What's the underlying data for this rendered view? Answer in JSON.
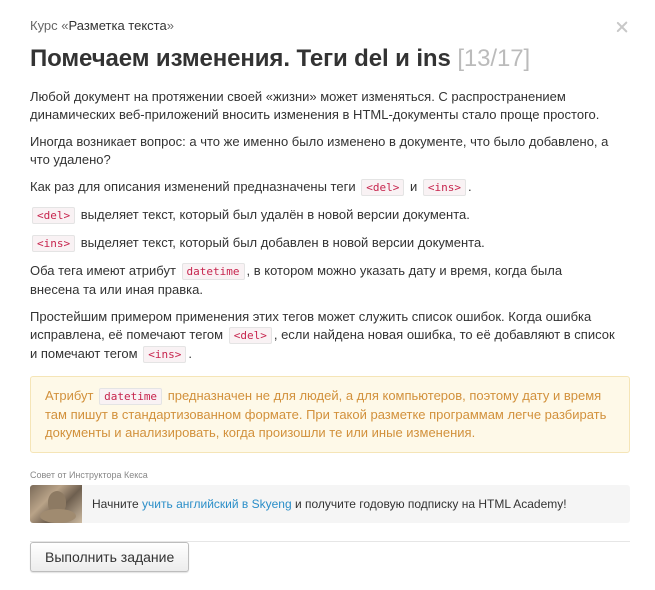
{
  "breadcrumb": {
    "prefix": "Курс «",
    "course": "Разметка текста",
    "suffix": "»"
  },
  "title": {
    "text": "Помечаем изменения. Теги del и ins",
    "counter": "[13/17]"
  },
  "paragraphs": {
    "p1": "Любой документ на протяжении своей «жизни» может изменяться. С распространением динамических веб-приложений вносить изменения в HTML-документы стало проще простого.",
    "p2": "Иногда возникает вопрос: а что же именно было изменено в документе, что было добавлено, а что удалено?",
    "p3_a": "Как раз для описания изменений предназначены теги",
    "p3_code1": "<del>",
    "p3_b": "и",
    "p3_code2": "<ins>",
    "p3_c": ".",
    "p4_code": "<del>",
    "p4_text": "выделяет текст, который был удалён в новой версии документа.",
    "p5_code": "<ins>",
    "p5_text": "выделяет текст, который был добавлен в новой версии документа.",
    "p6_a": "Оба тега имеют атрибут",
    "p6_code": "datetime",
    "p6_b": ", в котором можно указать дату и время, когда была внесена та или иная правка.",
    "p7_a": "Простейшим примером применения этих тегов может служить список ошибок. Когда ошибка исправлена, её помечают тегом",
    "p7_code1": "<del>",
    "p7_b": ", если найдена новая ошибка, то её добавляют в список и помечают тегом",
    "p7_code2": "<ins>",
    "p7_c": "."
  },
  "note": {
    "a": "Атрибут",
    "code": "datetime",
    "b": "предназначен не для людей, а для компьютеров, поэтому дату и время там пишут в стандартизованном формате. При такой разметке программам легче разбирать документы и анализировать, когда произошли те или иные изменения."
  },
  "tip_label": "Совет от Инструктора Кекса",
  "promo": {
    "a": "Начните",
    "link": "учить английский в Skyeng",
    "b": "и получите годовую подписку на HTML Academy!"
  },
  "action_button": "Выполнить задание",
  "colors": {
    "accent_link": "#2a8ec8",
    "note_text": "#d2913c",
    "note_bg": "#fef9e8",
    "code_text": "#c7254e"
  }
}
